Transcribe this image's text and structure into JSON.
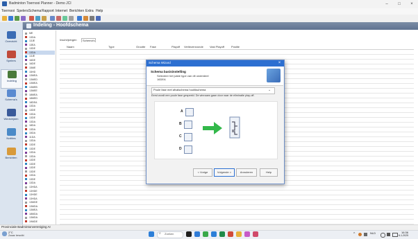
{
  "window": {
    "title": "Badminton Toernooi Planner - Demo JCI",
    "controls": [
      "–",
      "□",
      "×"
    ]
  },
  "menu": [
    "Toernooi",
    "Spelers",
    "Schema",
    "Rapport",
    "Internet",
    "Berichten",
    "Extra",
    "Help"
  ],
  "nav": [
    {
      "label": "Overzicht",
      "icon": "overview-icon"
    },
    {
      "label": "Spelers",
      "icon": "players-icon"
    },
    {
      "label": "Indeling",
      "icon": "draw-icon"
    },
    {
      "label": "Schema's",
      "icon": "schedule-icon"
    },
    {
      "label": "Wedstrijden",
      "icon": "matches-icon"
    },
    {
      "label": "Notities",
      "icon": "notes-icon"
    },
    {
      "label": "Berichten",
      "icon": "messages-icon"
    }
  ],
  "header": {
    "title": "Indeling - Hoofdschema"
  },
  "events": [
    "ME",
    "13DA",
    "13JE",
    "13EA",
    "13DE",
    "13DA",
    "13JE",
    "16DE",
    "16DE",
    "15ME",
    "15HD",
    "13MEA",
    "13MED",
    "13MEA",
    "13MEB",
    "13MEE",
    "18MEA",
    "18MED",
    "18DEA",
    "13DA",
    "13DE",
    "13DA",
    "13DE",
    "13DA",
    "18DA",
    "13DA",
    "15DA",
    "11DA",
    "13DA",
    "13DE",
    "13DE",
    "13DA",
    "13DA",
    "13DE",
    "13DE",
    "13DE",
    "13DE",
    "13DA",
    "13DE",
    "13DA",
    "13HDA",
    "13HDE",
    "13HDE",
    "13HDA",
    "13MDE",
    "13MDA",
    "13MEA",
    "18MDA",
    "13MDA",
    "19MDE"
  ],
  "selected_event_index": 5,
  "tabs": [
    "Inschrijvingen",
    "Schema's"
  ],
  "grid_columns": [
    "Naam",
    "Type",
    "Grootte",
    "Fase",
    "Playoff",
    "Verliezersronde",
    "Vast Playoff",
    "Positie"
  ],
  "status": {
    "text": "Provinciale Badmintonvereniging Ar"
  },
  "taskbar": {
    "weather": "2°C",
    "weather_sub": "Zwaar bewolkt",
    "search_placeholder": "Zoeken",
    "clock_time": "16:36",
    "clock_date": "6-1-2025",
    "lang": "NLD"
  },
  "dialog": {
    "title": "Schema Wizard",
    "close": "×",
    "heading": "Schema basisinstelling",
    "subheading": "Selecteer het juiste type van dit onderdeel",
    "event_code": "16DEA",
    "selected_type": "Poule fase met afvalschema hoofdschema",
    "info": "Eerst wordt een poule fase gespeeld. De winnaars gaan door naar de eliminatie play-off.",
    "slots": [
      "A",
      "B",
      "C",
      "D"
    ],
    "buttons": {
      "back": "< Vorige",
      "next": "Volgende >",
      "cancel": "Annuleren",
      "help": "Help"
    },
    "colors": {
      "arrow": "#33b84a",
      "title_bar": "#2c6fd1"
    }
  }
}
